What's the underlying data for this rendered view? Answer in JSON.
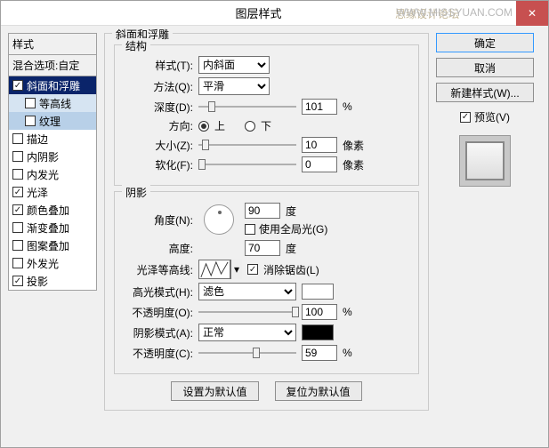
{
  "title": "图层样式",
  "watermark": "WWW.MISSYUAN.COM",
  "watermark2": "思缘设计论坛",
  "left": {
    "header": "样式",
    "blend": "混合选项:自定",
    "items": [
      {
        "label": "斜面和浮雕",
        "checked": true,
        "selected": true
      },
      {
        "label": "等高线",
        "checked": false,
        "sub": true
      },
      {
        "label": "纹理",
        "checked": false,
        "sub": true,
        "sel2": true
      },
      {
        "label": "描边",
        "checked": false
      },
      {
        "label": "内阴影",
        "checked": false
      },
      {
        "label": "内发光",
        "checked": false
      },
      {
        "label": "光泽",
        "checked": true
      },
      {
        "label": "颜色叠加",
        "checked": true
      },
      {
        "label": "渐变叠加",
        "checked": false
      },
      {
        "label": "图案叠加",
        "checked": false
      },
      {
        "label": "外发光",
        "checked": false
      },
      {
        "label": "投影",
        "checked": true
      }
    ]
  },
  "main": {
    "group_title": "斜面和浮雕",
    "structure": {
      "legend": "结构",
      "style_label": "样式(T):",
      "style_val": "内斜面",
      "method_label": "方法(Q):",
      "method_val": "平滑",
      "depth_label": "深度(D):",
      "depth_val": "101",
      "depth_pct": "%",
      "dir_label": "方向:",
      "dir_up": "上",
      "dir_down": "下",
      "size_label": "大小(Z):",
      "size_val": "10",
      "size_unit": "像素",
      "soft_label": "软化(F):",
      "soft_val": "0",
      "soft_unit": "像素"
    },
    "shadow": {
      "legend": "阴影",
      "angle_label": "角度(N):",
      "angle_val": "90",
      "angle_unit": "度",
      "global_label": "使用全局光(G)",
      "alt_label": "高度:",
      "alt_val": "70",
      "alt_unit": "度",
      "contour_label": "光泽等高线:",
      "anti_label": "消除锯齿(L)",
      "hi_mode_label": "高光模式(H):",
      "hi_mode_val": "滤色",
      "hi_op_label": "不透明度(O):",
      "hi_op_val": "100",
      "pct": "%",
      "sh_mode_label": "阴影模式(A):",
      "sh_mode_val": "正常",
      "sh_op_label": "不透明度(C):",
      "sh_op_val": "59"
    },
    "reset1": "设置为默认值",
    "reset2": "复位为默认值"
  },
  "right": {
    "ok": "确定",
    "cancel": "取消",
    "new_style": "新建样式(W)...",
    "preview": "预览(V)"
  }
}
